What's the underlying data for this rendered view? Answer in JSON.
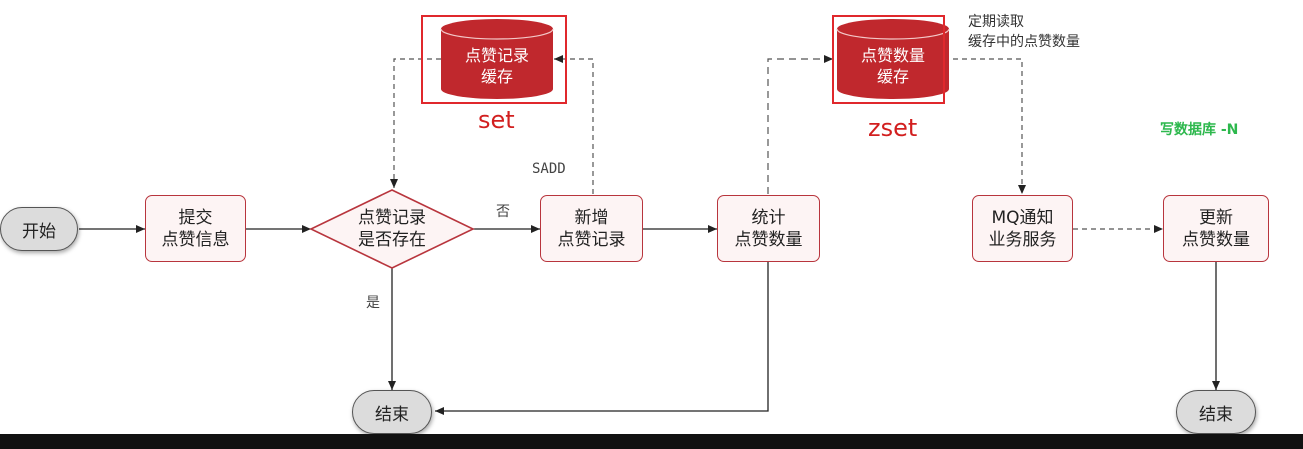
{
  "nodes": {
    "start": "开始",
    "submit": [
      "提交",
      "点赞信息"
    ],
    "decision": [
      "点赞记录",
      "是否存在"
    ],
    "add_record": [
      "新增",
      "点赞记录"
    ],
    "count": [
      "统计",
      "点赞数量"
    ],
    "mq": [
      "MQ通知",
      "业务服务"
    ],
    "update": [
      "更新",
      "点赞数量"
    ],
    "end_left": "结束",
    "end_right": "结束"
  },
  "caches": {
    "record_cache": [
      "点赞记录",
      "缓存"
    ],
    "record_type": "set",
    "count_cache": [
      "点赞数量",
      "缓存"
    ],
    "count_type": "zset"
  },
  "edge_labels": {
    "no": "否",
    "yes": "是",
    "sadd": "SADD",
    "periodic_read": [
      "定期读取",
      "缓存中的点赞数量"
    ],
    "write_db": "写数据库 -N"
  },
  "colors": {
    "accent_red": "#b8353d",
    "cache_red": "#c0282d",
    "highlight_red": "#e0282c",
    "write_db_green": "#2db84d"
  }
}
